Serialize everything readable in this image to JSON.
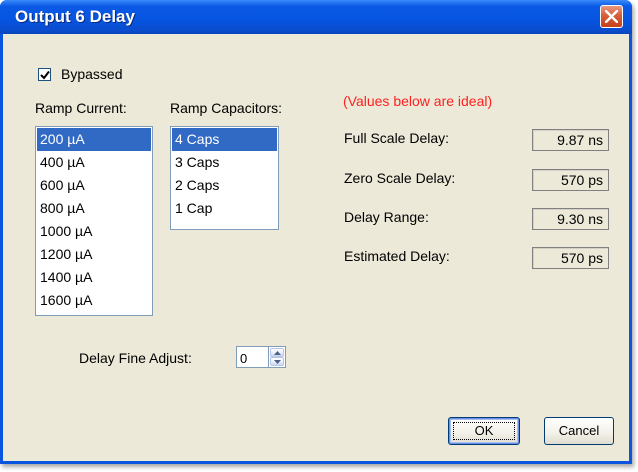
{
  "window": {
    "title": "Output 6 Delay"
  },
  "bypass": {
    "label": "Bypassed",
    "checked": true
  },
  "ramp_current": {
    "label": "Ramp Current:",
    "items": [
      "200 µA",
      "400 µA",
      "600 µA",
      "800 µA",
      "1000 µA",
      "1200 µA",
      "1400 µA",
      "1600 µA"
    ],
    "selected_index": 0
  },
  "ramp_capacitors": {
    "label": "Ramp Capacitors:",
    "items": [
      "4 Caps",
      "3 Caps",
      "2 Caps",
      "1 Cap"
    ],
    "selected_index": 0
  },
  "ideal_note": "(Values below are ideal)",
  "readouts": [
    {
      "label": "Full Scale Delay:",
      "value": "9.87 ns"
    },
    {
      "label": "Zero Scale Delay:",
      "value": "570 ps"
    },
    {
      "label": "Delay Range:",
      "value": "9.30 ns"
    },
    {
      "label": "Estimated Delay:",
      "value": "570 ps"
    }
  ],
  "fine_adjust": {
    "label": "Delay Fine Adjust:",
    "value": "0"
  },
  "buttons": {
    "ok": "OK",
    "cancel": "Cancel"
  },
  "colors": {
    "titlebar": "#0054e3",
    "selection": "#316ac5",
    "note_text": "#ff2020",
    "dialog_bg": "#ece9d8"
  },
  "icons": {
    "close": "close-icon",
    "check": "checkmark-icon",
    "spin_up": "chevron-up-icon",
    "spin_down": "chevron-down-icon"
  }
}
